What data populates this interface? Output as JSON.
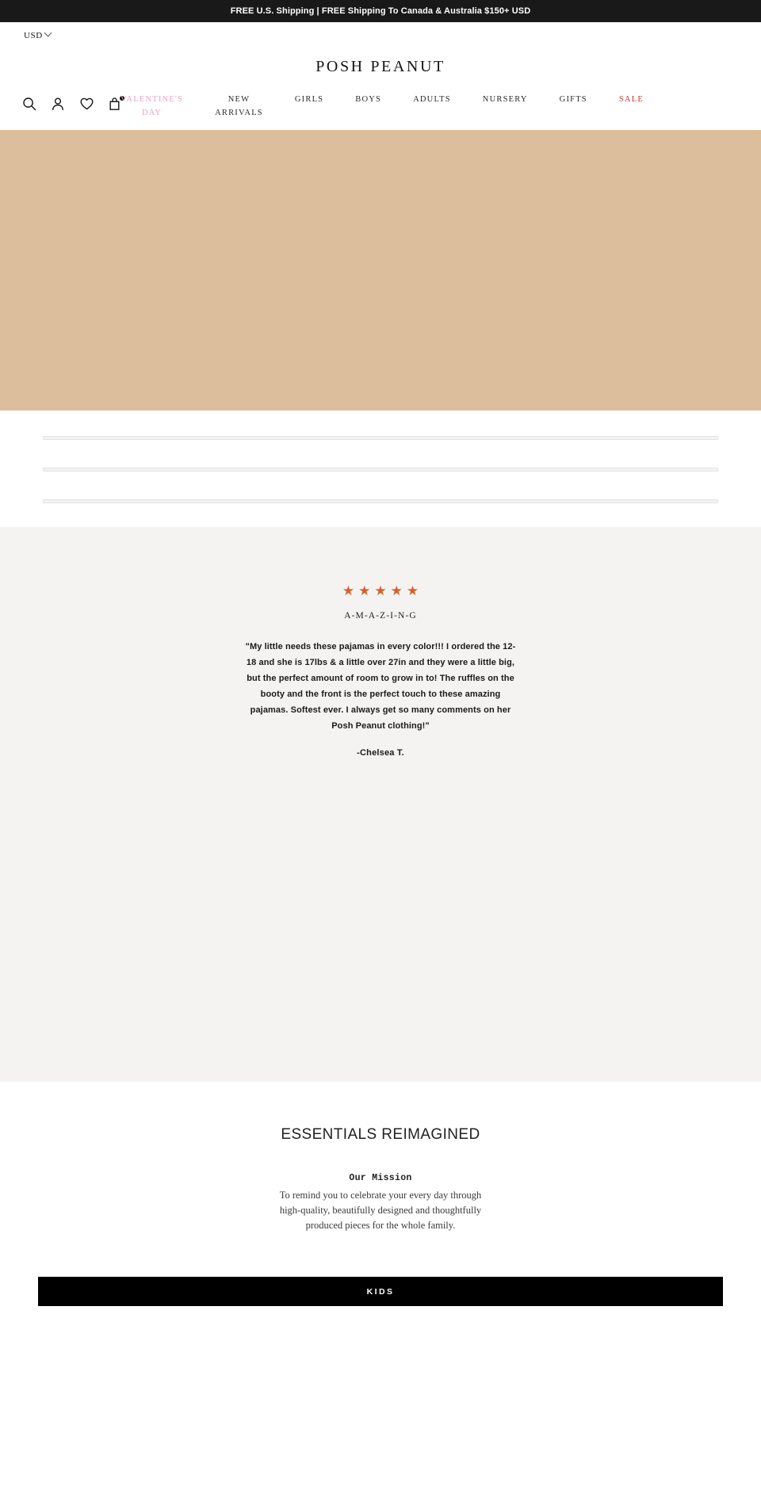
{
  "announcement": {
    "text": "FREE U.S. Shipping  |  FREE Shipping To Canada & Australia $150+ USD"
  },
  "utility": {
    "currency_label": "USD",
    "chevron_icon": "chevron-down-icon"
  },
  "header": {
    "logo": "POSH PEANUT",
    "icons": [
      {
        "name": "search-icon",
        "label": "Search"
      },
      {
        "name": "account-icon",
        "label": "Account"
      },
      {
        "name": "wishlist-heart-icon",
        "label": "Wishlist"
      },
      {
        "name": "cart-bag-icon",
        "label": "Cart"
      }
    ],
    "cart_badge": ""
  },
  "nav": {
    "items": [
      {
        "label": "VALENTINE'S\nDAY",
        "style": "valentines"
      },
      {
        "label": "NEW\nARRIVALS",
        "style": "default"
      },
      {
        "label": "GIRLS",
        "style": "default"
      },
      {
        "label": "BOYS",
        "style": "default"
      },
      {
        "label": "ADULTS",
        "style": "default"
      },
      {
        "label": "NURSERY",
        "style": "default"
      },
      {
        "label": "GIFTS",
        "style": "default"
      },
      {
        "label": "SALE",
        "style": "sale"
      }
    ]
  },
  "hero": {
    "background_color": "#ddbe9c"
  },
  "skeleton": {
    "lines": [
      1,
      2,
      3
    ]
  },
  "testimonial": {
    "background_color": "#f4f3f1",
    "star_color": "#d2622c",
    "star_count": 5,
    "star_glyph": "★",
    "title": "A-M-A-Z-I-N-G",
    "body": "\"My little needs these pajamas in every color!!! I ordered the 12-18 and she is 17lbs & a little over 27in and they were a little big, but the perfect amount of room to grow in to! The ruffles on the booty and the front is the perfect touch to these amazing pajamas. Softest ever. I always get so many comments on her Posh Peanut clothing!\"",
    "author": "-Chelsea T."
  },
  "essentials": {
    "title": "ESSENTIALS REIMAGINED",
    "mission_label": "Our Mission",
    "mission_text": "To remind you to celebrate your every day through high-quality, beautifully designed and thoughtfully produced pieces for the whole family."
  },
  "cta": {
    "kids_label": "KIDS",
    "background_color": "#000000"
  }
}
